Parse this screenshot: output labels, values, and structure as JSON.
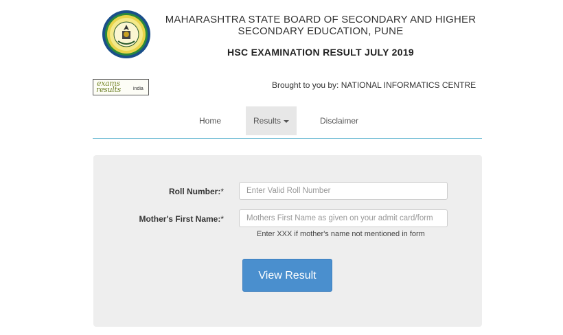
{
  "header": {
    "board_line1": "MAHARASHTRA STATE BOARD OF SECONDARY AND HIGHER",
    "board_line2": "SECONDARY EDUCATION, PUNE",
    "exam_title": "HSC EXAMINATION RESULT JULY 2019"
  },
  "subheader": {
    "logo_line1": "exams",
    "logo_line2": "results",
    "logo_line3": "india",
    "brought_by": "Brought to you by: NATIONAL INFORMATICS CENTRE"
  },
  "nav": {
    "items": [
      {
        "label": "Home"
      },
      {
        "label": "Results"
      },
      {
        "label": "Disclaimer"
      }
    ],
    "active": "Results"
  },
  "form": {
    "roll_label": "Roll Number:",
    "roll_required": "*",
    "roll_placeholder": "Enter Valid Roll Number",
    "roll_value": "",
    "mother_label": "Mother's First Name:",
    "mother_required": "*",
    "mother_placeholder": "Mothers First Name as given on your admit card/form",
    "mother_value": "",
    "hint": "Enter XXX if mother's name not mentioned in form",
    "submit_label": "View Result"
  },
  "colors": {
    "accent": "#4a8fce",
    "nav_border": "#5bb3cf",
    "panel_bg": "#eeeeee"
  }
}
